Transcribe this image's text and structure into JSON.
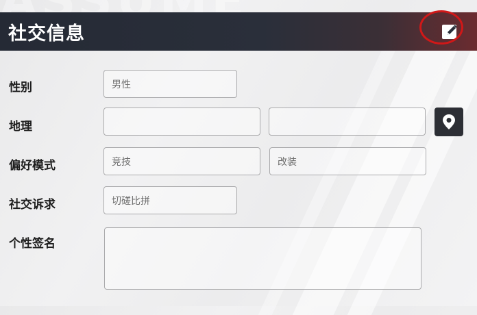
{
  "header": {
    "title": "社交信息",
    "watermark": "ASSUME"
  },
  "form": {
    "gender": {
      "label": "性别",
      "value": "男性"
    },
    "location": {
      "label": "地理",
      "value1": "",
      "value2": ""
    },
    "preference": {
      "label": "偏好模式",
      "value1": "竞技",
      "value2": "改装"
    },
    "social_goal": {
      "label": "社交诉求",
      "value": "切磋比拼"
    },
    "signature": {
      "label": "个性签名",
      "value": ""
    }
  },
  "icons": {
    "edit": "edit-icon",
    "location": "map-pin-icon"
  },
  "colors": {
    "header_bg": "#252a35",
    "header_accent": "#6b2c30",
    "highlight_ring": "#d01818",
    "location_button_bg": "#2d2f35"
  }
}
